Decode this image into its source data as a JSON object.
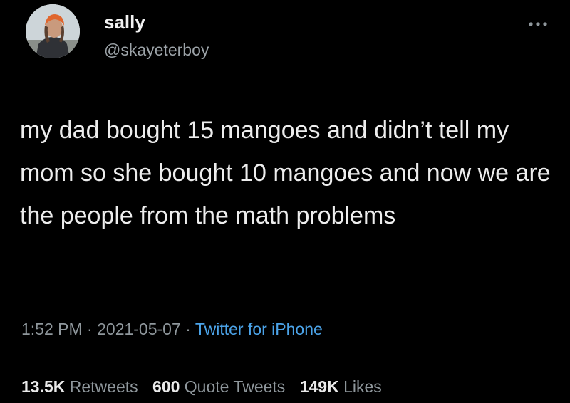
{
  "user": {
    "display_name": "sally",
    "handle": "@skayeterboy"
  },
  "tweet": {
    "text": "my dad bought 15 mangoes and didn’t tell my mom so she bought 10 mangoes and now we are the people from the math problems"
  },
  "meta": {
    "time": "1:52 PM",
    "date": "2021-05-07",
    "separator": "·",
    "source": "Twitter for iPhone"
  },
  "stats": {
    "retweets_count": "13.5K",
    "retweets_label": "Retweets",
    "quote_count": "600",
    "quote_label": "Quote Tweets",
    "likes_count": "149K",
    "likes_label": "Likes"
  },
  "icons": {
    "more": "more-horizontal-icon"
  },
  "colors": {
    "background": "#000000",
    "text": "#ededed",
    "secondary": "#8f979c",
    "link": "#4ba3e8"
  }
}
